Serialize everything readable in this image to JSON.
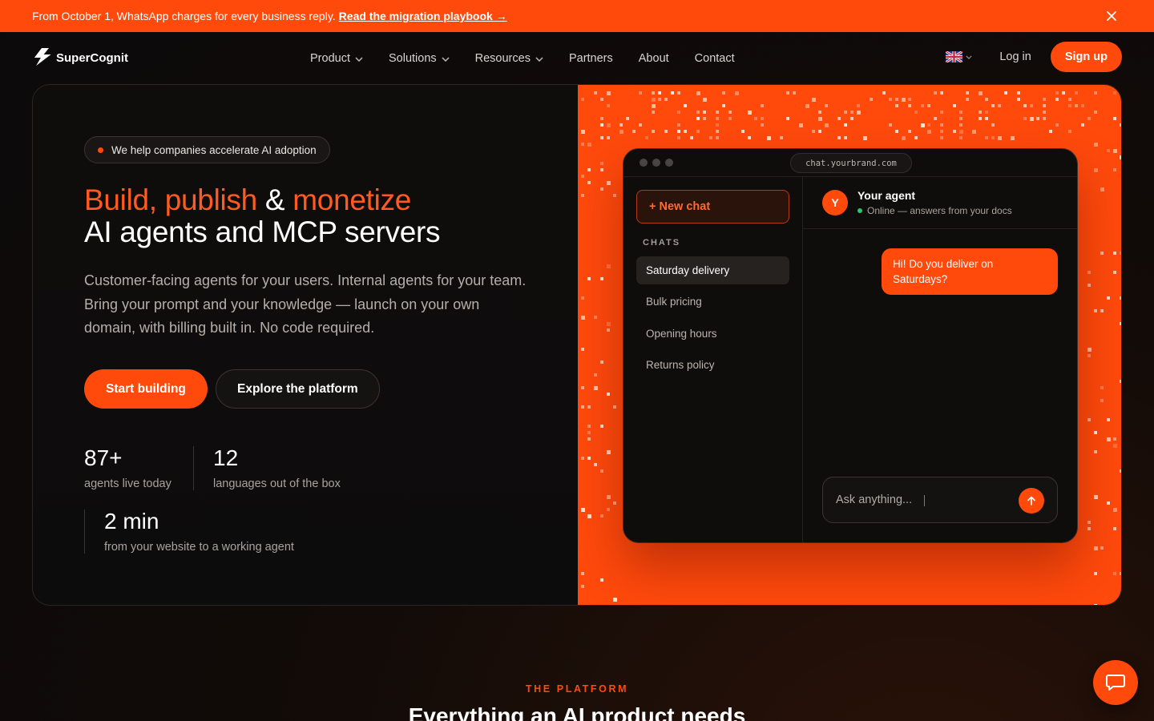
{
  "announcement": {
    "text": "From October 1, WhatsApp charges for every business reply.",
    "link": "Read the migration playbook →"
  },
  "nav": {
    "brand": "SuperCognit",
    "items": [
      {
        "label": "Product",
        "dropdown": true
      },
      {
        "label": "Solutions",
        "dropdown": true
      },
      {
        "label": "Resources",
        "dropdown": true
      },
      {
        "label": "Partners",
        "dropdown": false
      },
      {
        "label": "About",
        "dropdown": false
      },
      {
        "label": "Contact",
        "dropdown": false
      }
    ],
    "language_icon": "uk-flag-icon",
    "login": "Log in",
    "signup": "Sign up"
  },
  "hero": {
    "badge": "We help companies accelerate AI adoption",
    "headline": {
      "w1": "Build",
      "c1": ",",
      "w2": "publish",
      "amp": "&",
      "w3": "monetize",
      "line2": "AI agents and MCP servers"
    },
    "subtitle": "Customer-facing agents for your users. Internal agents for your team. Bring your prompt and your knowledge — launch on your own domain, with billing built in. No code required.",
    "cta_primary": "Start building",
    "cta_secondary": "Explore the platform",
    "stats": [
      {
        "value": "87+",
        "label": "agents live today"
      },
      {
        "value": "12",
        "label": "languages out of the box"
      },
      {
        "value": "2 min",
        "label": "from your website to a working agent"
      }
    ]
  },
  "chat_demo": {
    "url": "chat.yourbrand.com",
    "new_chat": "+ New chat",
    "chats_heading": "CHATS",
    "chats": [
      "Saturday delivery",
      "Bulk pricing",
      "Opening hours",
      "Returns policy"
    ],
    "active_chat": 0,
    "agent_initial": "Y",
    "agent_name": "Your agent",
    "agent_status": "Online — answers from your docs",
    "user_message": "Hi! Do you deliver on Saturdays?",
    "input_placeholder": "Ask anything..."
  },
  "platform": {
    "eyebrow": "THE PLATFORM",
    "title": "Everything an AI product needs"
  },
  "colors": {
    "accent": "#ff4a0c",
    "background": "#0d0b0a",
    "online": "#28c76f"
  }
}
